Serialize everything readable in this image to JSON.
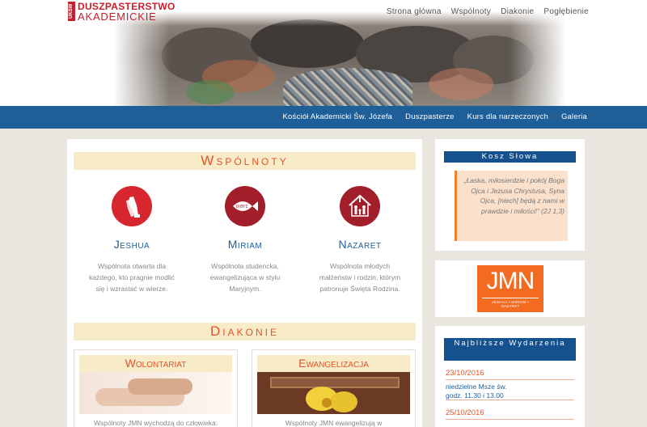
{
  "logo": {
    "tag": "UKSW",
    "line1": "DUSZPASTERSTWO",
    "line2": "AKADEMICKIE"
  },
  "top_nav": [
    "Strona główna",
    "Wspólnoty",
    "Diakonie",
    "Pogłębienie"
  ],
  "blue_nav": [
    "Kościół Akademicki Św. Józefa",
    "Duszpasterze",
    "Kurs dla narzeczonych",
    "Galeria"
  ],
  "wspolnoty": {
    "heading": "Wspólnoty",
    "items": [
      {
        "name": "Jeshua",
        "icon": "praying-hands-icon",
        "desc": "Wspólnota otwarta dla każdego, kto pragnie modlić się i wzrastać w wierze."
      },
      {
        "name": "Miriam",
        "icon": "ichthys-fish-icon",
        "icon_text": "ΙΧΘΥΣ",
        "desc": "Wspólnota studencka, ewangelizująca w stylu Maryjnym."
      },
      {
        "name": "Nazaret",
        "icon": "family-house-icon",
        "desc": "Wspólnota młodych małżeństw i rodzin, którym patronuje Święta Rodzina."
      }
    ],
    "colors": {
      "circle": "#d7262d",
      "circle_dark": "#a31e2b"
    }
  },
  "diakonie": {
    "heading": "Diakonie",
    "cards": [
      {
        "title": "Wolontariat",
        "text": "Wspólnoty JMN wychodzą do człowieka:"
      },
      {
        "title": "Ewangelizacja",
        "text": "Wspólnoty JMN ewangelizują w"
      }
    ]
  },
  "sidebar": {
    "kosz": {
      "heading": "Kosz Słowa",
      "quote": "„Łaska, miłosierdzie i pokój Boga Ojca i Jezusa Chrystusa, Syna Ojca, [niech] będą z nami w prawdzie i miłości!” (2J 1,3)"
    },
    "jmn": {
      "big": "JMN",
      "small": "JESHUA • MIRIAM • NAZARET"
    },
    "events": {
      "heading": "Najbliższe Wydarzenia",
      "items": [
        {
          "date": "23/10/2016",
          "desc": "niedzielne Msze św. godz. 11.30 i 13.00"
        },
        {
          "date": "25/10/2016",
          "desc": ""
        }
      ]
    }
  },
  "colors": {
    "accent": "#e0542a",
    "nav_blue": "#1e5f9a",
    "heading_bg": "#f7ecc7",
    "jmn_orange": "#f36b21"
  }
}
